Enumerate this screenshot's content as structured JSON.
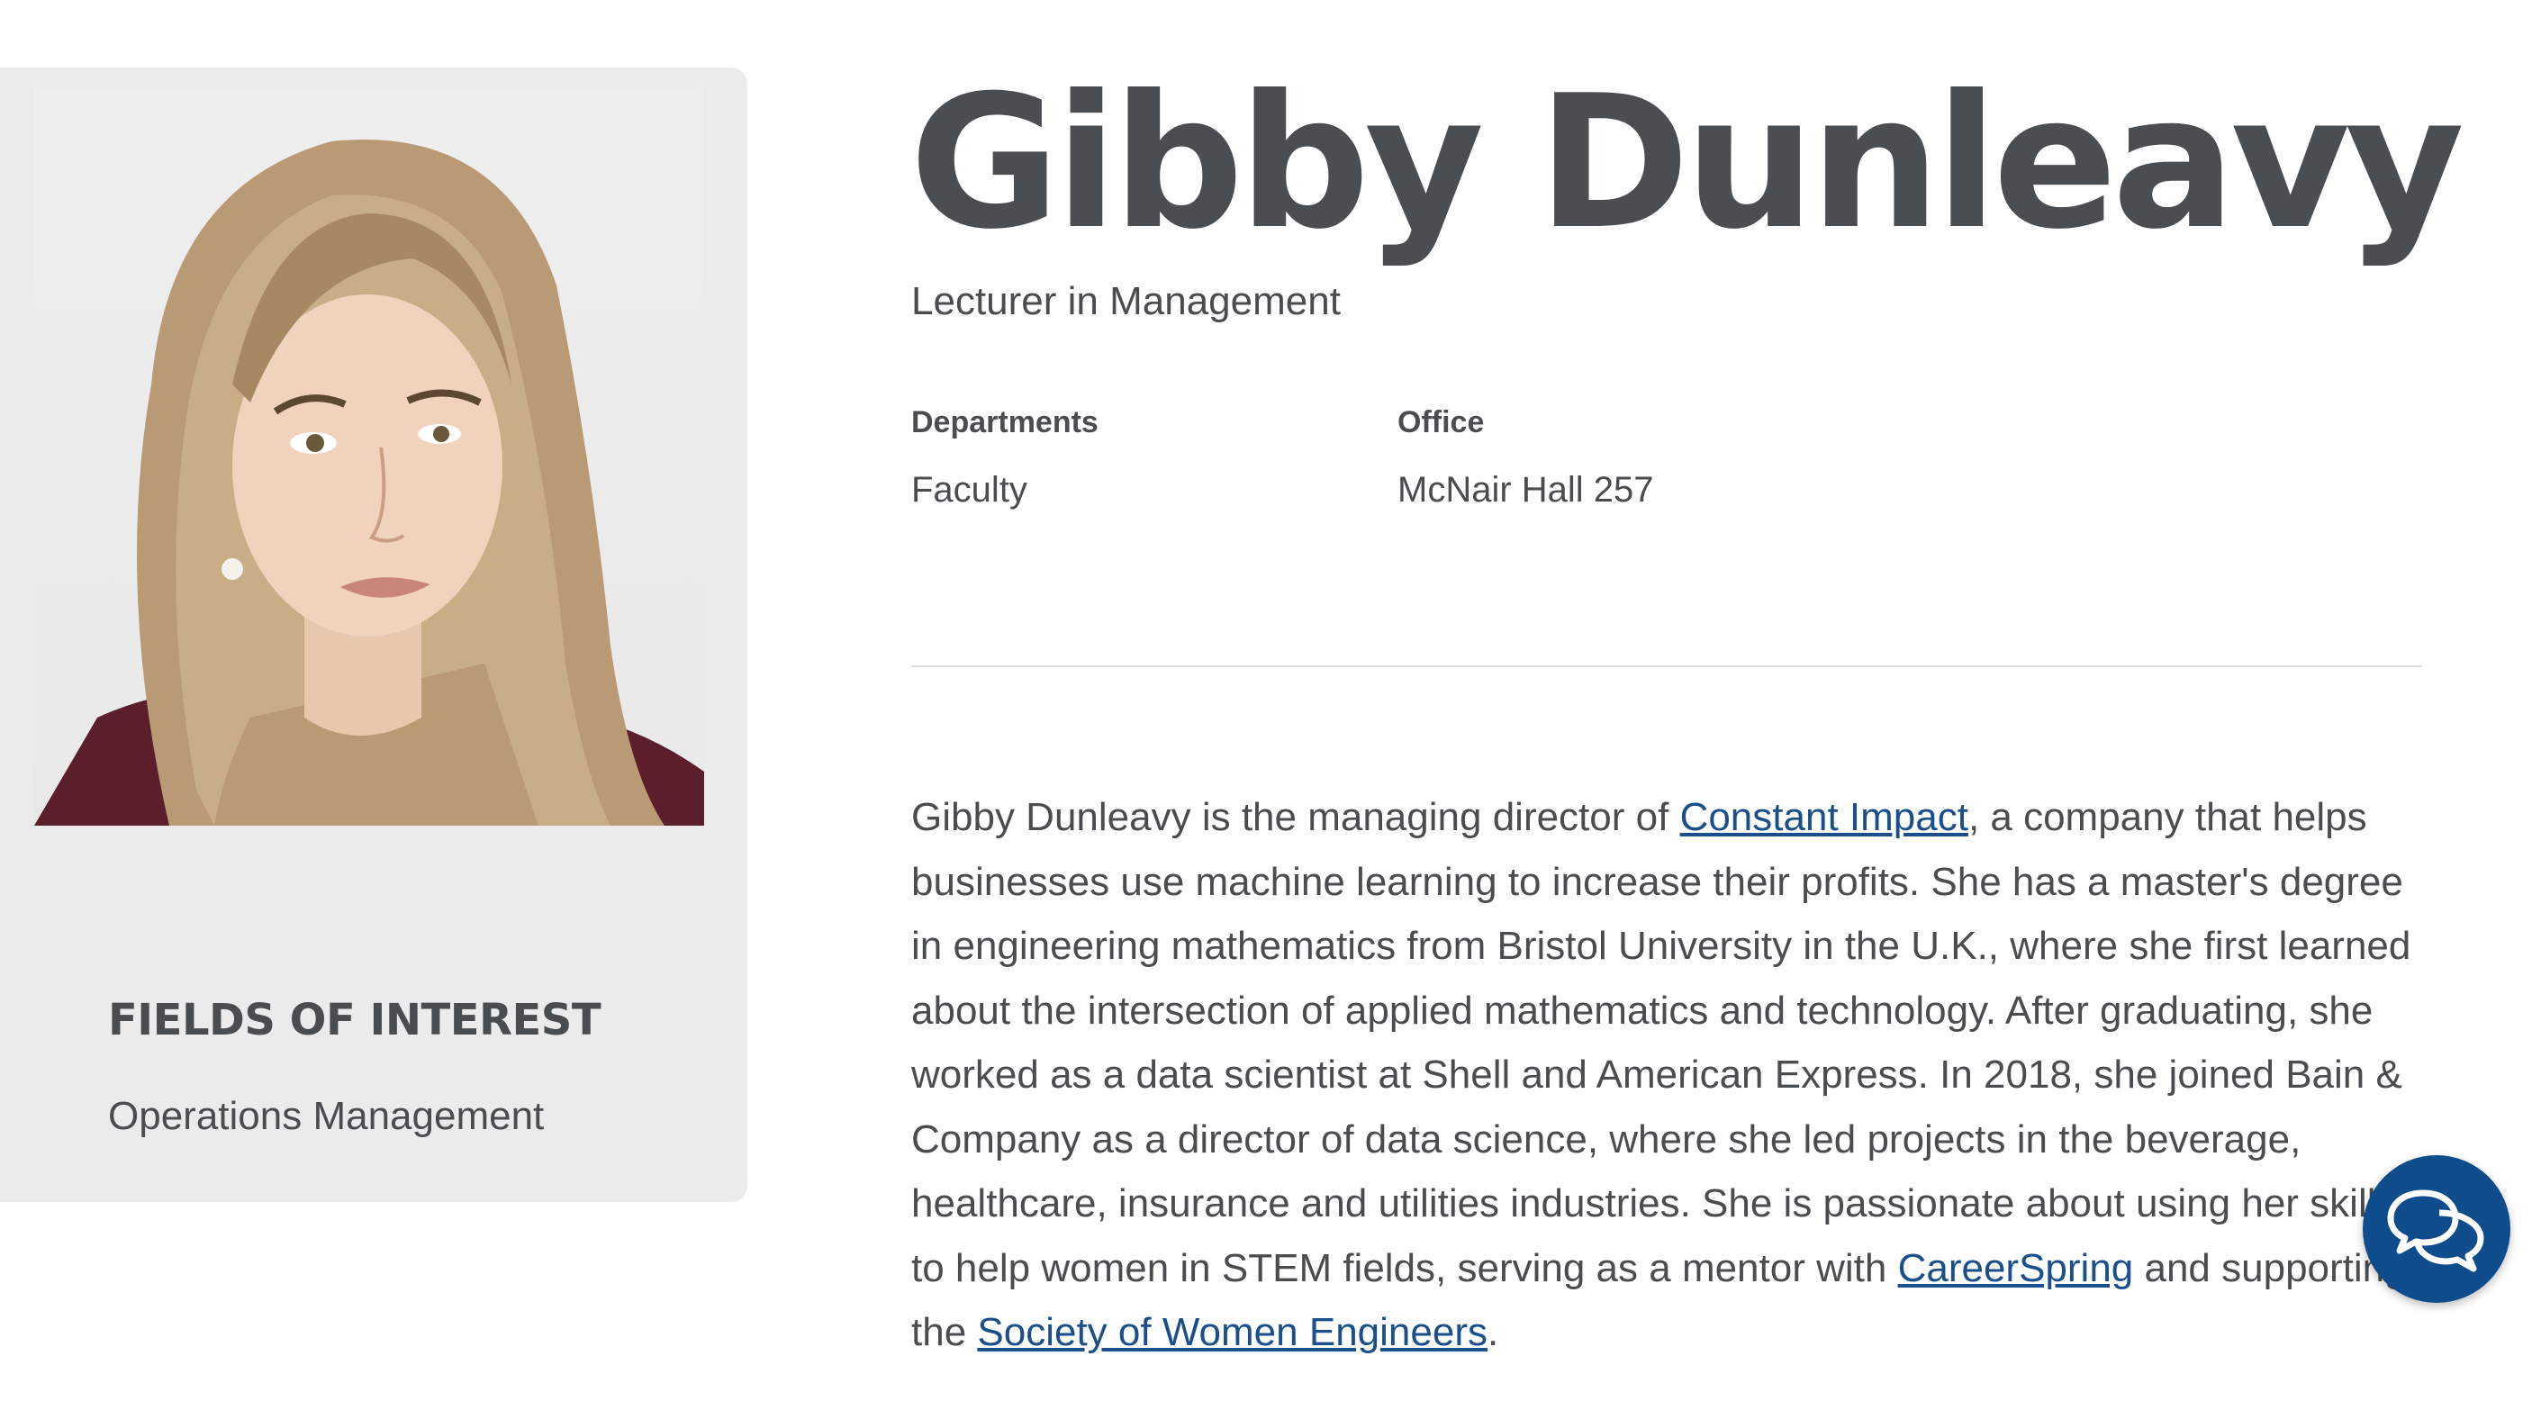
{
  "profile": {
    "name": "Gibby Dunleavy",
    "title": "Lecturer in Management",
    "departments_label": "Departments",
    "departments_value": "Faculty",
    "office_label": "Office",
    "office_value": "McNair Hall 257"
  },
  "sidebar": {
    "fields_heading": "FIELDS OF INTEREST",
    "fields_value": "Operations Management"
  },
  "bio": {
    "part1": "Gibby Dunleavy is the managing director of ",
    "link1": "Constant Impact",
    "part2": ", a company that helps businesses use machine learning to increase their profits. She has a master's degree in engineering mathematics from Bristol University in the U.K., where she first learned about the intersection of applied mathematics and technology. After graduating, she worked as a data scientist at Shell and American Express. In 2018, she joined Bain & Company as a director of data science, where she led projects in the beverage, healthcare, insurance and utilities industries. She is passionate about using her skills to help women in STEM fields, serving as a mentor with ",
    "link2": "CareerSpring",
    "part3": " and supporting the ",
    "link3": "Society of Women Engineers",
    "part4": "."
  },
  "chat": {
    "icon": "chat-bubbles-icon",
    "color": "#0f4c8c"
  },
  "colors": {
    "text": "#4a4d50",
    "link": "#1a4f8b",
    "card_bg": "#ebebeb"
  }
}
